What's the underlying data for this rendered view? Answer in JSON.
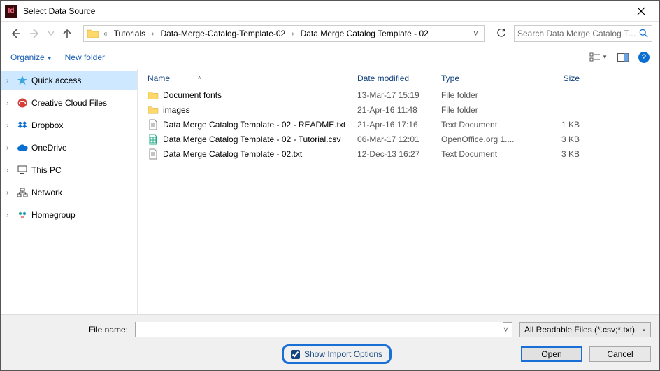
{
  "title": "Select Data Source",
  "breadcrumbs": [
    "Tutorials",
    "Data-Merge-Catalog-Template-02",
    "Data Merge Catalog Template - 02"
  ],
  "search_placeholder": "Search Data Merge Catalog Te...",
  "toolbar": {
    "organize": "Organize",
    "newfolder": "New folder"
  },
  "sidebar": [
    {
      "label": "Quick access",
      "icon": "star",
      "selected": true
    },
    {
      "label": "Creative Cloud Files",
      "icon": "cc"
    },
    {
      "label": "Dropbox",
      "icon": "dropbox"
    },
    {
      "label": "OneDrive",
      "icon": "onedrive"
    },
    {
      "label": "This PC",
      "icon": "pc"
    },
    {
      "label": "Network",
      "icon": "network"
    },
    {
      "label": "Homegroup",
      "icon": "homegroup"
    }
  ],
  "columns": {
    "name": "Name",
    "date": "Date modified",
    "type": "Type",
    "size": "Size"
  },
  "files": [
    {
      "name": "Document fonts",
      "date": "13-Mar-17 15:19",
      "type": "File folder",
      "size": "",
      "icon": "folder"
    },
    {
      "name": "images",
      "date": "21-Apr-16 11:48",
      "type": "File folder",
      "size": "",
      "icon": "folder"
    },
    {
      "name": "Data Merge Catalog Template - 02 - README.txt",
      "date": "21-Apr-16 17:16",
      "type": "Text Document",
      "size": "1 KB",
      "icon": "txt"
    },
    {
      "name": "Data Merge Catalog Template - 02 - Tutorial.csv",
      "date": "06-Mar-17 12:01",
      "type": "OpenOffice.org 1....",
      "size": "3 KB",
      "icon": "csv"
    },
    {
      "name": "Data Merge Catalog Template - 02.txt",
      "date": "12-Dec-13 16:27",
      "type": "Text Document",
      "size": "3 KB",
      "icon": "txt"
    }
  ],
  "filename_label": "File name:",
  "filename_value": "",
  "filetype": "All Readable Files (*.csv;*.txt)",
  "show_import": "Show Import Options",
  "buttons": {
    "open": "Open",
    "cancel": "Cancel"
  }
}
